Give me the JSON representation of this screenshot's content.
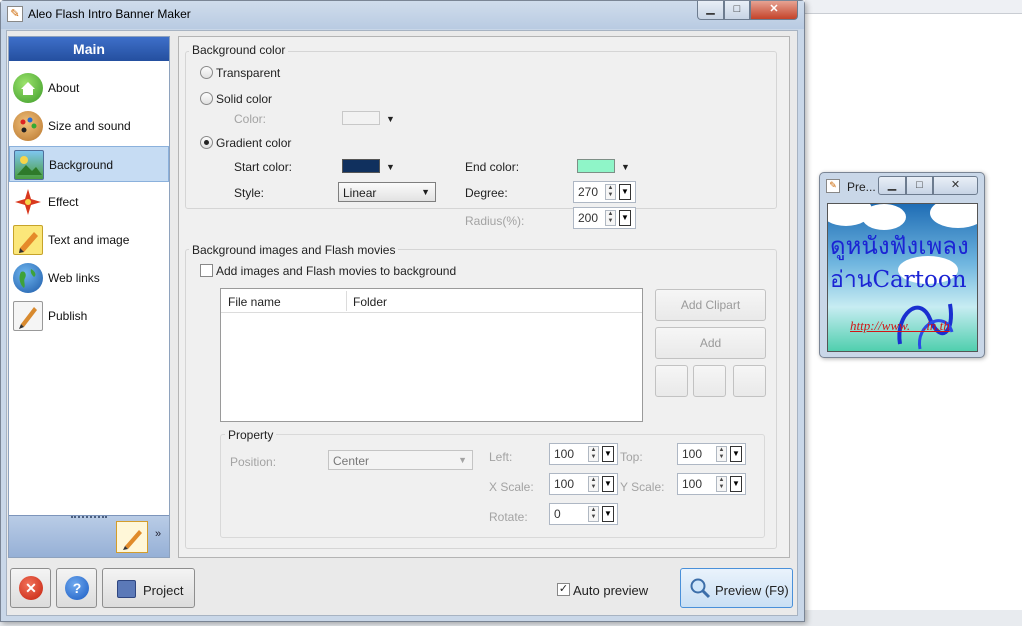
{
  "window": {
    "title": "Aleo Flash Intro Banner Maker",
    "min_glyph": "▁",
    "max_glyph": "□",
    "close_glyph": "✕"
  },
  "sidebar": {
    "header": "Main",
    "items": [
      {
        "label": "About",
        "icon": "home-icon"
      },
      {
        "label": "Size and sound",
        "icon": "palette-icon"
      },
      {
        "label": "Background",
        "icon": "background-image-icon",
        "selected": true
      },
      {
        "label": "Effect",
        "icon": "sparkle-icon"
      },
      {
        "label": "Text and image",
        "icon": "pencil-icon"
      },
      {
        "label": "Web links",
        "icon": "globe-icon"
      },
      {
        "label": "Publish",
        "icon": "publish-pen-icon"
      }
    ],
    "footer_chevron": "»"
  },
  "background_color": {
    "group_title": "Background color",
    "transparent_label": "Transparent",
    "solid_label": "Solid color",
    "color_label": "Color:",
    "gradient_label": "Gradient color",
    "selected": "gradient",
    "start_color_label": "Start color:",
    "start_color": "#10305e",
    "end_color_label": "End color:",
    "end_color": "#8ff5c8",
    "style_label": "Style:",
    "style_value": "Linear",
    "degree_label": "Degree:",
    "degree_value": "270",
    "radius_label": "Radius(%):",
    "radius_value": "200"
  },
  "background_images": {
    "group_title": "Background images and Flash movies",
    "add_checkbox_label": "Add images and Flash movies to background",
    "columns": [
      "File name",
      "Folder"
    ],
    "rows": [],
    "add_clipart_label": "Add Clipart",
    "add_label": "Add"
  },
  "property": {
    "title": "Property",
    "position_label": "Position:",
    "position_value": "Center",
    "left_label": "Left:",
    "left_value": "100",
    "top_label": "Top:",
    "top_value": "100",
    "xscale_label": "X Scale:",
    "xscale_value": "100",
    "yscale_label": "Y Scale:",
    "yscale_value": "100",
    "rotate_label": "Rotate:",
    "rotate_value": "0"
  },
  "bottom": {
    "project_label": "Project",
    "auto_preview_label": "Auto preview",
    "auto_preview_checked": true,
    "preview_label": "Preview (F9)"
  },
  "preview_window": {
    "title": "Pre...",
    "banner_line1": "ดูหนังฟังเพลง",
    "banner_line2": "อ่านCartoon",
    "banner_link": "http://www.    .in.th"
  }
}
